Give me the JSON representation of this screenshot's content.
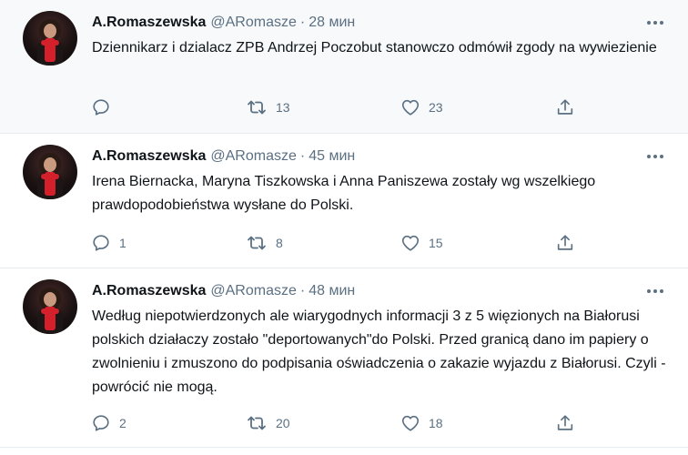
{
  "tweets": [
    {
      "name": "A.Romaszewska",
      "handle": "@ARomasze",
      "separator": "·",
      "time": "28 мин",
      "text": "Dziennikarz i dzialacz  ZPB Andrzej Poczobut stanowczo odmówił  zgody na wywiezienie",
      "replies": "",
      "retweets": "13",
      "likes": "23"
    },
    {
      "name": "A.Romaszewska",
      "handle": "@ARomasze",
      "separator": "·",
      "time": "45 мин",
      "text": "Irena Biernacka, Maryna Tiszkowska i Anna Paniszewa zostały wg wszelkiego prawdopodobieństwa wysłane do Polski.",
      "replies": "1",
      "retweets": "8",
      "likes": "15"
    },
    {
      "name": "A.Romaszewska",
      "handle": "@ARomasze",
      "separator": "·",
      "time": "48 мин",
      "text": "Według niepotwierdzonych ale wiarygodnych informacji 3 z 5 więzionych na Białorusi polskich działaczy zostało \"deportowanych\"do Polski. Przed granicą dano im papiery o zwolnieniu i zmuszono do podpisania oświadczenia o zakazie wyjazdu z Białorusi. Czyli - powrócić nie mogą.",
      "replies": "2",
      "retweets": "20",
      "likes": "18"
    }
  ],
  "icons": {
    "reply": "reply-icon",
    "retweet": "retweet-icon",
    "like": "like-icon",
    "share": "share-icon",
    "more": "more-icon"
  },
  "colors": {
    "text": "#0f1419",
    "secondary": "#5b7083",
    "border": "#e6ecf0",
    "scarf": "#d3202a"
  }
}
